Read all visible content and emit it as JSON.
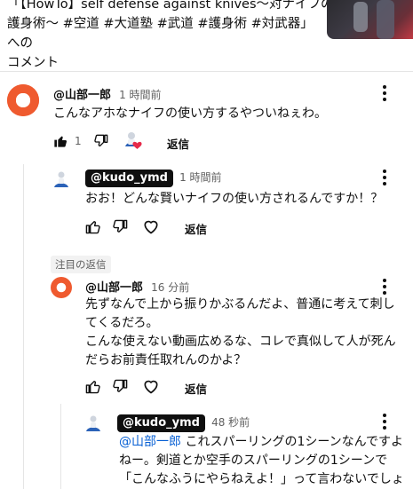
{
  "header": {
    "title_line1": "「【HowTo】self defense against knives〜対ナイフの",
    "title_line2": "護身術〜 #空道 #大道塾 #武道 #護身術 #対武器」への",
    "title_line3": "コメント"
  },
  "comment_main": {
    "author": "@山部一郎",
    "time": "1 時間前",
    "text": "こんなアホなナイフの使い方するやついねぇわ。",
    "likes": "1",
    "reply_label": "返信"
  },
  "reply1": {
    "author": "@kudo_ymd",
    "time": "1 時間前",
    "text": "おお！どんな賢いナイフの使い方されるんですか！？",
    "reply_label": "返信"
  },
  "featured_label": "注目の返信",
  "reply2": {
    "author": "@山部一郎",
    "time": "16 分前",
    "text_line1": "先ずなんで上から振りかぶるんだよ、普通に考えて刺し",
    "text_line2": "てくるだろ。",
    "text_line3": "こんな使えない動画広めるな、コレで真似して人が死ん",
    "text_line4": "だらお前責任取れんのかよ？",
    "reply_label": "返信"
  },
  "reply3": {
    "author": "@kudo_ymd",
    "time": "48 秒前",
    "mention": "@山部一郎",
    "text_line1": " これスパーリングの1シーンなんですよ",
    "text_line2": "ねー。剣道とか空手のスパーリングの1シーンで",
    "text_line3": "「こんなふうにやらねえよ！」って言わないでしょ"
  },
  "colors": {
    "accent_orange": "#ef5a2f",
    "heart": "#e62a4a",
    "mention": "#065fd4"
  }
}
